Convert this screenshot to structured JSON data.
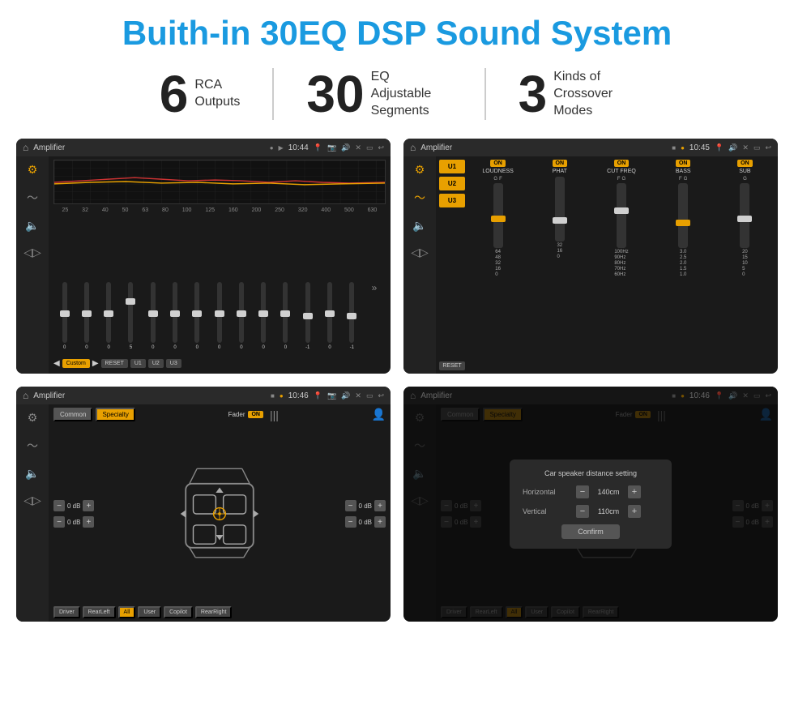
{
  "title": "Buith-in 30EQ DSP Sound System",
  "stats": [
    {
      "number": "6",
      "label": "RCA\nOutputs"
    },
    {
      "number": "30",
      "label": "EQ Adjustable\nSegments"
    },
    {
      "number": "3",
      "label": "Kinds of\nCrossover Modes"
    }
  ],
  "screens": {
    "eq": {
      "title": "Amplifier",
      "time": "10:44",
      "frequencies": [
        "25",
        "32",
        "40",
        "50",
        "63",
        "80",
        "100",
        "125",
        "160",
        "200",
        "250",
        "320",
        "400",
        "500",
        "630"
      ],
      "sliderValues": [
        "0",
        "0",
        "0",
        "5",
        "0",
        "0",
        "0",
        "0",
        "0",
        "0",
        "0",
        "-1",
        "0",
        "-1"
      ],
      "presets": [
        "Custom",
        "RESET",
        "U1",
        "U2",
        "U3"
      ]
    },
    "crossover": {
      "title": "Amplifier",
      "time": "10:45",
      "presets": [
        "U1",
        "U2",
        "U3"
      ],
      "channels": [
        {
          "label": "LOUDNESS",
          "on": true
        },
        {
          "label": "PHAT",
          "on": true
        },
        {
          "label": "CUT FREQ",
          "on": true
        },
        {
          "label": "BASS",
          "on": true
        },
        {
          "label": "SUB",
          "on": true
        }
      ],
      "resetLabel": "RESET"
    },
    "fader": {
      "title": "Amplifier",
      "time": "10:46",
      "tabs": [
        "Common",
        "Specialty"
      ],
      "activeTab": "Specialty",
      "faderLabel": "Fader",
      "faderOn": "ON",
      "speakerValues": [
        "0 dB",
        "0 dB",
        "0 dB",
        "0 dB"
      ],
      "zones": [
        "Driver",
        "Copilot",
        "RearLeft",
        "All",
        "User",
        "RearRight"
      ]
    },
    "dialog": {
      "title": "Amplifier",
      "time": "10:46",
      "dialogTitle": "Car speaker distance setting",
      "horizontal": "140cm",
      "vertical": "110cm",
      "confirmLabel": "Confirm",
      "speakerValues": [
        "0 dB",
        "0 dB"
      ]
    }
  }
}
